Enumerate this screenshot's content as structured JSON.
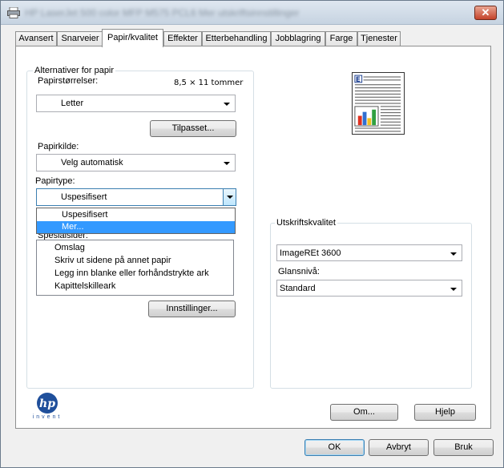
{
  "window": {
    "title": "HP LaserJet 500 color MFP M575 PCL6 Mer utskriftsinnstillinger",
    "close_symbol": "✕"
  },
  "tabs": [
    {
      "label": "Avansert"
    },
    {
      "label": "Snarveier"
    },
    {
      "label": "Papir/kvalitet"
    },
    {
      "label": "Effekter"
    },
    {
      "label": "Etterbehandling"
    },
    {
      "label": "Jobblagring"
    },
    {
      "label": "Farge"
    },
    {
      "label": "Tjenester"
    }
  ],
  "paper_options": {
    "group_title": "Alternativer for papir",
    "size_label": "Papirstørrelser:",
    "size_value_text": "8,5 × 11 tommer",
    "size_selected": "Letter",
    "custom_button": "Tilpasset...",
    "source_label": "Papirkilde:",
    "source_selected": "Velg automatisk",
    "type_label": "Papirtype:",
    "type_selected": "Uspesifisert",
    "type_dropdown_options": [
      "Uspesifisert",
      "Mer..."
    ],
    "type_dropdown_highlighted": "Mer...",
    "special_pages_label": "Spesialsider:",
    "special_pages": [
      "Omslag",
      "Skriv ut sidene på annet papir",
      "Legg inn blanke eller forhåndstrykte ark",
      "Kapittelskilleark"
    ],
    "settings_button": "Innstillinger..."
  },
  "print_quality": {
    "group_title": "Utskriftskvalitet",
    "quality_selected": "ImageREt 3600",
    "gloss_label": "Glansnivå:",
    "gloss_selected": "Standard"
  },
  "logo": {
    "mark": "hp",
    "tagline": "invent",
    "color": "#1f4f9b"
  },
  "buttons": {
    "about": "Om...",
    "help": "Hjelp",
    "ok": "OK",
    "cancel": "Avbryt",
    "apply": "Bruk"
  },
  "icons": {
    "window_icon": "printer-icon",
    "preview": "page-preview-icon"
  }
}
